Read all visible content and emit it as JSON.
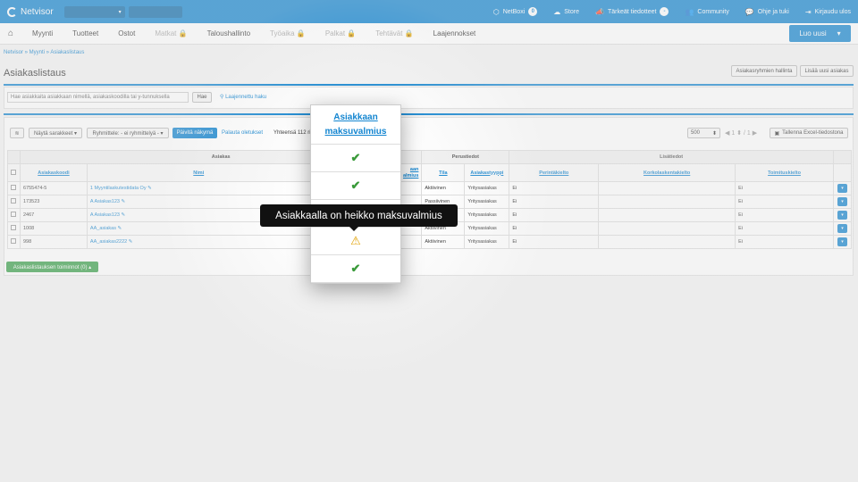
{
  "topbar": {
    "logo": "Netvisor",
    "select_arrow": "▾",
    "items": [
      {
        "icon": "cube-icon",
        "glyph": "⬡",
        "label": "NetBoxi",
        "badge": "0"
      },
      {
        "icon": "cloud-icon",
        "glyph": "☁",
        "label": "Store"
      },
      {
        "icon": "megaphone-icon",
        "glyph": "📣",
        "label": "Tärkeät tiedotteet",
        "badge": "-"
      },
      {
        "icon": "users-icon",
        "glyph": "👥",
        "label": "Community"
      },
      {
        "icon": "chat-icon",
        "glyph": "💬",
        "label": "Ohje ja tuki"
      },
      {
        "icon": "logout-icon",
        "glyph": "⇥",
        "label": "Kirjaudu ulos"
      }
    ]
  },
  "nav": {
    "home_glyph": "⌂",
    "items": [
      {
        "label": "Myynti",
        "disabled": false
      },
      {
        "label": "Tuotteet",
        "disabled": false
      },
      {
        "label": "Ostot",
        "disabled": false
      },
      {
        "label": "Matkat 🔒",
        "disabled": true
      },
      {
        "label": "Taloushallinto",
        "disabled": false
      },
      {
        "label": "Työaika 🔒",
        "disabled": true
      },
      {
        "label": "Palkat 🔒",
        "disabled": true
      },
      {
        "label": "Tehtävät 🔒",
        "disabled": true
      },
      {
        "label": "Laajennokset",
        "disabled": false
      }
    ],
    "create_button": "Luo uusi",
    "create_arrow": "▾"
  },
  "breadcrumb": "Netvisor » Myynti » Asiakaslistaus",
  "page_title": "Asiakaslistaus",
  "header_buttons": {
    "groups": "Asiakasryhmien hallinta",
    "add": "Lisää uusi asiakas"
  },
  "search": {
    "placeholder": "Hae asiakkaita asiakkaan nimellä, asiakaskoodilla tai y-tunnuksella",
    "button": "Hae",
    "advanced": "Laajennettu haku",
    "advanced_icon": "⚲"
  },
  "toolbar": {
    "layers_glyph": "≋",
    "show_columns": "Näytä sarakkeet ▾",
    "grouping": "Ryhmittele: - ei ryhmittelyä - ▾",
    "refresh": "Päivitä näkymä",
    "reset": "Palauta oletukset",
    "total": "Yhteensä 112 ri",
    "page_size": "500",
    "page_size_arrow": "⬍",
    "pager": "◀ 1 ⬍ / 1 ▶",
    "excel": "Tallenna Excel-tiedostona",
    "excel_glyph": "▣"
  },
  "table": {
    "groups": [
      "Asiakas",
      "Perustiedot",
      "Lisätiedot"
    ],
    "columns": [
      "Asiakaskoodi",
      "Nimi",
      "aan\nalmius",
      "Tila",
      "Asiakastyyppi",
      "Perintäkielto",
      "Korkolaskentakielto",
      "Toimituskielto"
    ],
    "rows": [
      {
        "code": "6755474-5",
        "name": "1 Myyntilaskutestidata Oy",
        "status": "Aktiivinen",
        "type": "Yritysasiakas",
        "perinta": "Ei",
        "korko": "",
        "toimitus": "Ei"
      },
      {
        "code": "173523",
        "name": "A Asiakas123",
        "status": "Passiivinen",
        "type": "Yritysasiakas",
        "perinta": "Ei",
        "korko": "",
        "toimitus": "Ei"
      },
      {
        "code": "2467",
        "name": "A Asiakas123",
        "status": "Aktiivinen",
        "type": "Yritysasiakas",
        "perinta": "Ei",
        "korko": "",
        "toimitus": "Ei"
      },
      {
        "code": "1008",
        "name": "AA_asiakas",
        "status": "Aktiivinen",
        "type": "Yritysasiakas",
        "perinta": "Ei",
        "korko": "",
        "toimitus": "Ei"
      },
      {
        "code": "998",
        "name": "AA_asiakas2222",
        "status": "Aktiivinen",
        "type": "Yritysasiakas",
        "perinta": "Ei",
        "korko": "",
        "toimitus": "Ei"
      }
    ],
    "edit_glyph": "✎",
    "dd_glyph": "▾"
  },
  "actions_button": "Asiakaslistauksen toiminnot (0) ▴",
  "popup": {
    "title_line1": "Asiakkaan",
    "title_line2": "maksuvalmius",
    "cells": [
      "check",
      "check",
      "check",
      "warning",
      "check"
    ],
    "check_glyph": "✔",
    "warning_glyph": "⚠"
  },
  "tooltip": "Asiakkaalla on heikko maksuvalmius"
}
